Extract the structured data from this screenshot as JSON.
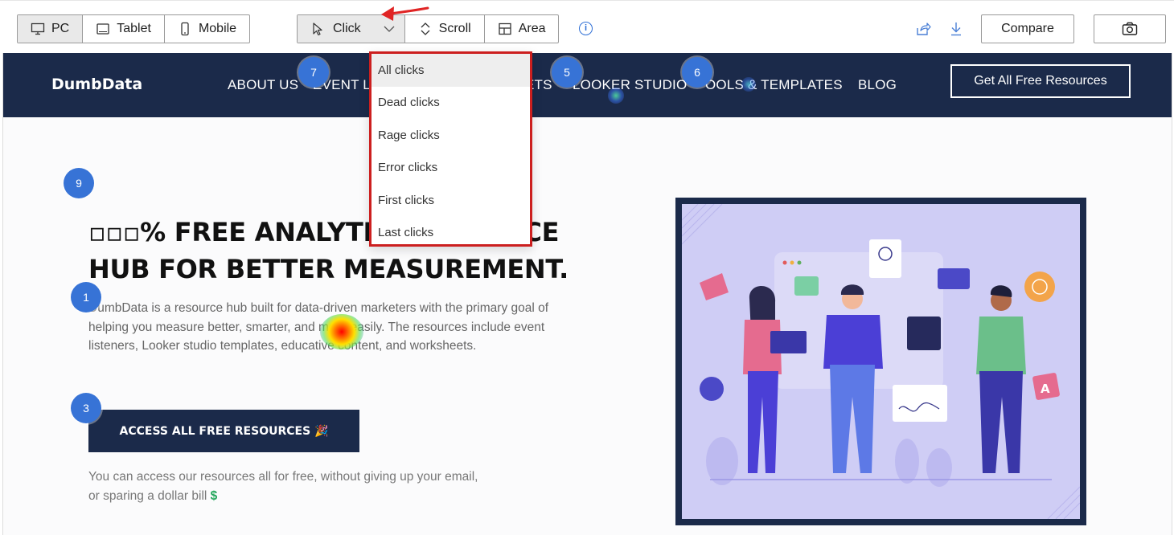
{
  "toolbar": {
    "device_tabs": [
      {
        "label": "PC",
        "icon": "desktop-icon"
      },
      {
        "label": "Tablet",
        "icon": "tablet-icon"
      },
      {
        "label": "Mobile",
        "icon": "mobile-icon"
      }
    ],
    "mode_tabs": [
      {
        "label": "Click",
        "icon": "cursor-icon"
      },
      {
        "label": "Scroll",
        "icon": "scroll-icon"
      },
      {
        "label": "Area",
        "icon": "area-icon"
      }
    ],
    "compare_label": "Compare"
  },
  "click_menu": {
    "items": [
      "All clicks",
      "Dead clicks",
      "Rage clicks",
      "Error clicks",
      "First clicks",
      "Last clicks"
    ],
    "selected": "All clicks"
  },
  "site": {
    "logo": "DumbData",
    "nav": [
      "ABOUT US",
      "EVENT L",
      "ETS",
      "LOOKER STUDIO",
      "OOLS & TEMPLATES",
      "BLOG"
    ],
    "nav_cta": "Get All Free Resources",
    "hero_title_line1": "▫▫▫% FREE ANALYTI",
    "hero_title_line1_end": "RCE",
    "hero_title_line2": "HUB FOR BETTER MEASUREMENT.",
    "hero_desc": "DumbData is a resource hub built for data-driven marketers with the primary goal of helping you measure better, smarter, and more easily. The resources include event listeners, Looker studio templates, educative content, and worksheets.",
    "hero_cta": "ACCESS ALL FREE RESOURCES 🎉",
    "hero_note": "You can access our resources all for free, without giving up your email, or sparing a dollar bill",
    "hero_note_icon": "$"
  },
  "click_badges": [
    "7",
    "5",
    "6",
    "9",
    "1",
    "3"
  ],
  "colors": {
    "nav_bg": "#1b2a4a",
    "badge": "#3773d6",
    "highlight_border": "#cc1f1f",
    "illustration_bg": "#cfcdf5"
  }
}
